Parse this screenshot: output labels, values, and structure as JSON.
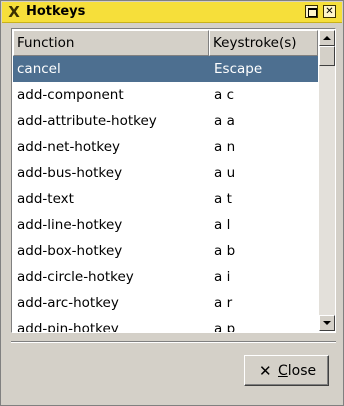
{
  "window": {
    "title": "Hotkeys",
    "icon": "x-app-icon",
    "maximize_icon": "maximize-icon",
    "close_icon": "close-icon"
  },
  "table": {
    "columns": [
      "Function",
      "Keystroke(s)"
    ],
    "selected_index": 0,
    "rows": [
      {
        "function": "cancel",
        "keys": "Escape"
      },
      {
        "function": "add-component",
        "keys": "a c"
      },
      {
        "function": "add-attribute-hotkey",
        "keys": "a a"
      },
      {
        "function": "add-net-hotkey",
        "keys": "a n"
      },
      {
        "function": "add-bus-hotkey",
        "keys": "a u"
      },
      {
        "function": "add-text",
        "keys": "a t"
      },
      {
        "function": "add-line-hotkey",
        "keys": "a l"
      },
      {
        "function": "add-box-hotkey",
        "keys": "a b"
      },
      {
        "function": "add-circle-hotkey",
        "keys": "a i"
      },
      {
        "function": "add-arc-hotkey",
        "keys": "a r"
      },
      {
        "function": "add-pin-hotkey",
        "keys": "a p"
      }
    ]
  },
  "footer": {
    "close_label_mnemonic": "C",
    "close_label_rest": "lose",
    "close_icon": "x-close-icon"
  },
  "colors": {
    "titlebar": "#f6df3a",
    "selection": "#4d6f90",
    "window_bg": "#d4d0c8"
  }
}
